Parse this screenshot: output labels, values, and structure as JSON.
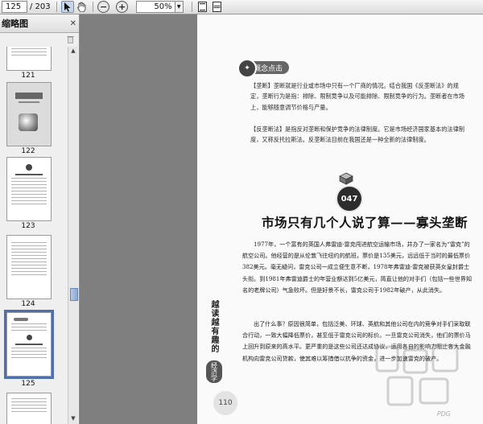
{
  "toolbar": {
    "current_page": "125",
    "page_sep": "/ 203",
    "zoom": "50%",
    "zoom_out": "−",
    "zoom_in": "+"
  },
  "sidebar": {
    "title": "缩略图",
    "thumbnails": [
      {
        "label": "121"
      },
      {
        "label": "122"
      },
      {
        "label": "123"
      },
      {
        "label": "124"
      },
      {
        "label": "125"
      }
    ]
  },
  "page": {
    "concept_tag": "概念点击",
    "concept_paragraphs": [
      "【垄断】垄断就是行业或市场中只有一个厂商的情况。结合我国《反垄断法》的规定，垄断行为是指：排除、限制竞争以及可能排除、限制竞争的行为。垄断者在市场上，能够随意调节价格与产量。",
      "【反垄断法】是指反对垄断和保护竞争的法律制度。它是市场经济国家基本的法律制度，又称反托拉斯法。反垄断法目前在我国还是一种全新的法律制度。"
    ],
    "number": "047",
    "chapter_title": "市场只有几个人说了算——寡头垄断",
    "body_paragraphs": [
      "1977年，一个富有的英国人弗雷迪·雷克闯进航空运输市场，并办了一家名为“雷克”的航空公司。他经营的是从伦敦飞往纽约的航班，票价是135美元，远远低于当时的最低票价382美元。毫无疑问，雷克公司一成立便生意不断，1978年弗雷迪·雷克被获英女皇封爵士头衔。到1981年弗雷迪爵士的年营业额达到5亿美元，简直让他的对手们（包括一些世界知名的老牌公司）气急败坏。但是好景不长，雷克公司于1982年破产，从此消失。",
      "出了什么事？原因很简单，包括泛美、环球、英航和其他公司在内的竞争对手们采取联合行动，一致大幅降低票价，甚至低于雷克公司的标价。一旦雷克公司消失，他们的票价马上回升到原来的高水平。更严重的是这些公司还达成协议，运用各自的影响力阻止各大金融机构向雷克公司贷款，使其难以筹措借以抗争的资金，进一步加速雷克的破产。"
    ],
    "vertical_text": "越读越有趣的",
    "vertical_badge": "经济学",
    "page_number": "110",
    "watermark": "PDG"
  }
}
